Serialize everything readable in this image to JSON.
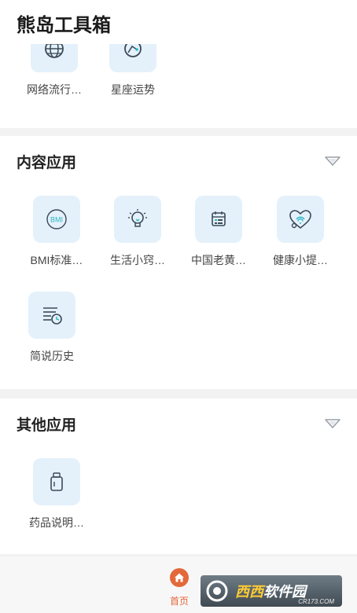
{
  "app": {
    "title": "熊岛工具箱"
  },
  "top_section": {
    "tools": [
      {
        "label": "网络流行…",
        "icon": "globe-icon"
      },
      {
        "label": "星座运势",
        "icon": "constellation-icon"
      }
    ]
  },
  "content_section": {
    "title": "内容应用",
    "tools": [
      {
        "label": "BMI标准…",
        "icon": "bmi-icon",
        "icon_text": "BMI"
      },
      {
        "label": "生活小窍…",
        "icon": "lightbulb-icon"
      },
      {
        "label": "中国老黄…",
        "icon": "calendar-icon"
      },
      {
        "label": "健康小提…",
        "icon": "heart-stethoscope-icon"
      },
      {
        "label": "简说历史",
        "icon": "history-list-icon"
      }
    ]
  },
  "other_section": {
    "title": "其他应用",
    "tools": [
      {
        "label": "药品说明…",
        "icon": "medicine-bottle-icon"
      }
    ]
  },
  "bottom_nav": {
    "home_label": "首页"
  },
  "watermark": {
    "name_a": "西西",
    "name_b": "软件园",
    "url": "CR173.COM"
  },
  "colors": {
    "icon_tile": "#e4f1fb",
    "icon_stroke": "#3a4a57",
    "accent_teal": "#2cb5c4",
    "home_active": "#e3683b"
  }
}
